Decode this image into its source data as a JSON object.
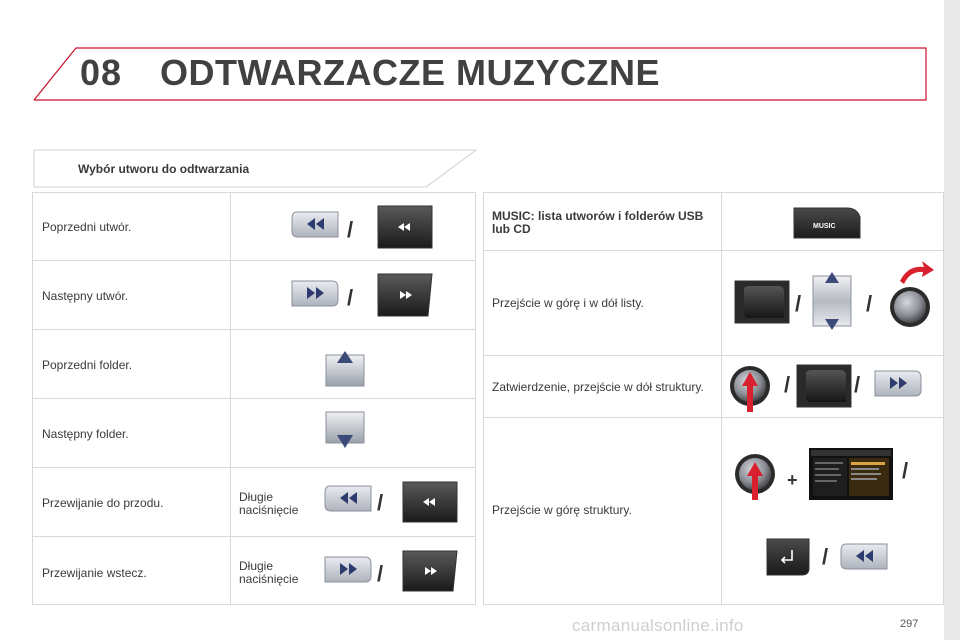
{
  "chapter": {
    "number": "08",
    "title": "ODTWARZACZE MUZYCZNE"
  },
  "section_title": "Wybór utworu do odtwarzania",
  "left_rows": [
    {
      "label": "Poprzedni utwór.",
      "hold": ""
    },
    {
      "label": "Następny utwór.",
      "hold": ""
    },
    {
      "label": "Poprzedni folder.",
      "hold": ""
    },
    {
      "label": "Następny folder.",
      "hold": ""
    },
    {
      "label": "Przewijanie do przodu.",
      "hold": "Długie naciśnięcie"
    },
    {
      "label": "Przewijanie wstecz.",
      "hold": "Długie naciśnięcie"
    }
  ],
  "right_rows": [
    {
      "label": "MUSIC: lista utworów i folderów USB lub CD"
    },
    {
      "label": "Przejście w górę i w dół listy."
    },
    {
      "label": "Zatwierdzenie, przejście w dół struktury."
    },
    {
      "label": "Przejście w górę struktury."
    }
  ],
  "music_button_label": "MUSIC",
  "separator": "/",
  "plus_sign": "+",
  "page_number": "297",
  "watermark": "carmanualsonline.info",
  "colors": {
    "accent_red": "#c8102e",
    "heading_gray": "#414141",
    "border_gray": "#d8d8d8",
    "button_dark": "#2c2c2c",
    "button_light": "#c9ccd3"
  }
}
